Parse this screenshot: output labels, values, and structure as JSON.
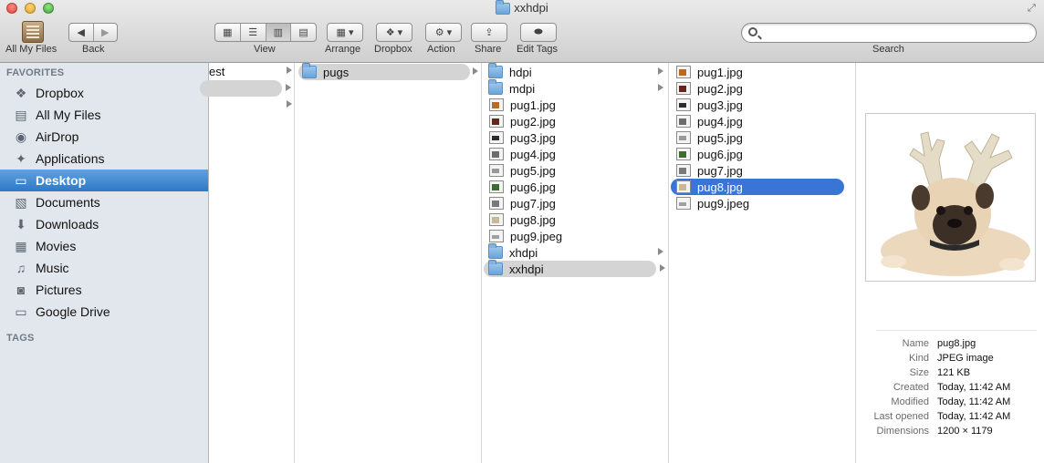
{
  "window": {
    "title": "xxhdpi"
  },
  "toolbar": {
    "all_my_files_label": "All My Files",
    "back_label": "Back",
    "view_label": "View",
    "arrange_label": "Arrange",
    "dropbox_label": "Dropbox",
    "action_label": "Action",
    "share_label": "Share",
    "edit_tags_label": "Edit Tags",
    "search_label": "Search",
    "search_value": "",
    "search_placeholder": ""
  },
  "sidebar": {
    "favorites_header": "FAVORITES",
    "tags_header": "TAGS",
    "items": [
      {
        "label": "Dropbox",
        "icon": "dropbox-icon"
      },
      {
        "label": "All My Files",
        "icon": "all-files-icon"
      },
      {
        "label": "AirDrop",
        "icon": "airdrop-icon"
      },
      {
        "label": "Applications",
        "icon": "applications-icon"
      },
      {
        "label": "Desktop",
        "icon": "desktop-icon",
        "selected": true
      },
      {
        "label": "Documents",
        "icon": "documents-icon"
      },
      {
        "label": "Downloads",
        "icon": "downloads-icon"
      },
      {
        "label": "Movies",
        "icon": "movies-icon"
      },
      {
        "label": "Music",
        "icon": "music-icon"
      },
      {
        "label": "Pictures",
        "icon": "pictures-icon"
      },
      {
        "label": "Google Drive",
        "icon": "folder-icon"
      }
    ]
  },
  "columns": {
    "col1": {
      "items": [
        {
          "label": "est",
          "has_children": true
        },
        {
          "label": "",
          "has_children": true,
          "grey": true
        },
        {
          "label": "",
          "has_children": true
        }
      ]
    },
    "col2": {
      "items": [
        {
          "label": "pugs",
          "has_children": true,
          "grey": true
        }
      ]
    },
    "col3": {
      "items": [
        {
          "label": "hdpi",
          "type": "folder",
          "has_children": true
        },
        {
          "label": "mdpi",
          "type": "folder",
          "has_children": true
        },
        {
          "label": "pug1.jpg",
          "type": "image"
        },
        {
          "label": "pug2.jpg",
          "type": "image"
        },
        {
          "label": "pug3.jpg",
          "type": "image"
        },
        {
          "label": "pug4.jpg",
          "type": "image"
        },
        {
          "label": "pug5.jpg",
          "type": "image"
        },
        {
          "label": "pug6.jpg",
          "type": "image"
        },
        {
          "label": "pug7.jpg",
          "type": "image"
        },
        {
          "label": "pug8.jpg",
          "type": "image"
        },
        {
          "label": "pug9.jpeg",
          "type": "image"
        },
        {
          "label": "xhdpi",
          "type": "folder",
          "has_children": true
        },
        {
          "label": "xxhdpi",
          "type": "folder",
          "has_children": true,
          "grey": true
        }
      ]
    },
    "col4": {
      "items": [
        {
          "label": "pug1.jpg"
        },
        {
          "label": "pug2.jpg"
        },
        {
          "label": "pug3.jpg"
        },
        {
          "label": "pug4.jpg"
        },
        {
          "label": "pug5.jpg"
        },
        {
          "label": "pug6.jpg"
        },
        {
          "label": "pug7.jpg"
        },
        {
          "label": "pug8.jpg",
          "selected": true
        },
        {
          "label": "pug9.jpeg"
        }
      ]
    }
  },
  "preview": {
    "info": [
      {
        "key": "Name",
        "value": "pug8.jpg"
      },
      {
        "key": "Kind",
        "value": "JPEG image"
      },
      {
        "key": "Size",
        "value": "121 KB"
      },
      {
        "key": "Created",
        "value": "Today, 11:42 AM"
      },
      {
        "key": "Modified",
        "value": "Today, 11:42 AM"
      },
      {
        "key": "Last opened",
        "value": "Today, 11:42 AM"
      },
      {
        "key": "Dimensions",
        "value": "1200 × 1179"
      }
    ]
  },
  "colors": {
    "selection_blue": "#3875d7",
    "sidebar_bg": "#e2e7ed",
    "sidebar_selected": "#2e78c6"
  }
}
